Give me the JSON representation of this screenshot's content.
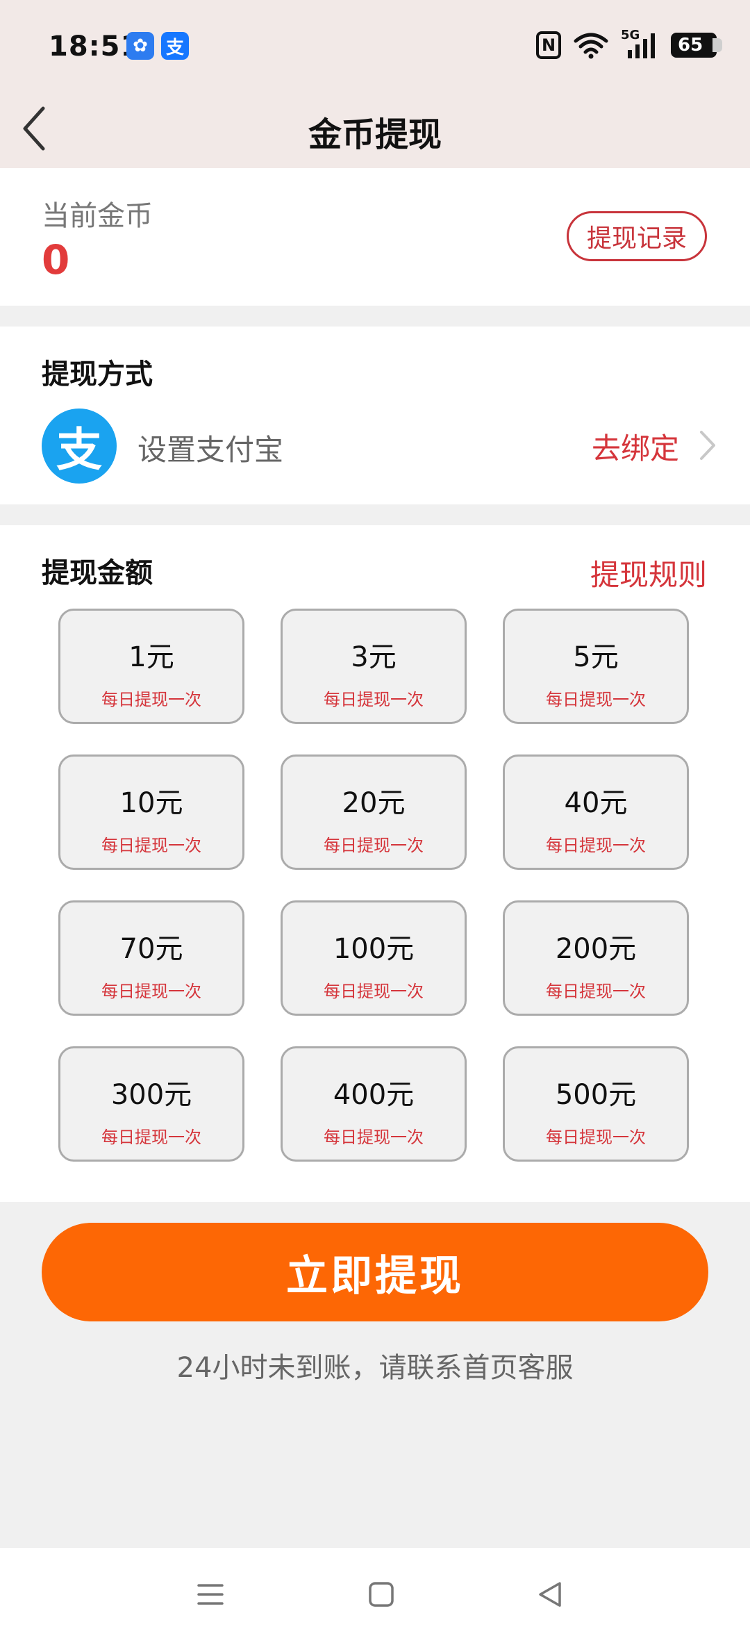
{
  "status_bar": {
    "time": "18:51",
    "app_icons": [
      "pinwheel-app-icon",
      "alipay-app-icon"
    ],
    "nfc": "N",
    "network": "5G",
    "battery": "65"
  },
  "header": {
    "title": "金币提现"
  },
  "coins": {
    "label": "当前金币",
    "value": "0",
    "record_button": "提现记录"
  },
  "method": {
    "title": "提现方式",
    "alipay_text": "设置支付宝",
    "bind_link": "去绑定"
  },
  "amount": {
    "title": "提现金额",
    "rules_link": "提现规则",
    "options": [
      {
        "value": "1元",
        "note": "每日提现一次"
      },
      {
        "value": "3元",
        "note": "每日提现一次"
      },
      {
        "value": "5元",
        "note": "每日提现一次"
      },
      {
        "value": "10元",
        "note": "每日提现一次"
      },
      {
        "value": "20元",
        "note": "每日提现一次"
      },
      {
        "value": "40元",
        "note": "每日提现一次"
      },
      {
        "value": "70元",
        "note": "每日提现一次"
      },
      {
        "value": "100元",
        "note": "每日提现一次"
      },
      {
        "value": "200元",
        "note": "每日提现一次"
      },
      {
        "value": "300元",
        "note": "每日提现一次"
      },
      {
        "value": "400元",
        "note": "每日提现一次"
      },
      {
        "value": "500元",
        "note": "每日提现一次"
      }
    ]
  },
  "action": {
    "withdraw_button": "立即提现",
    "tip": "24小时未到账，请联系首页客服"
  },
  "colors": {
    "accent_red": "#d5353b",
    "button_orange": "#fd6705",
    "alipay_blue": "#1aa3f0"
  }
}
